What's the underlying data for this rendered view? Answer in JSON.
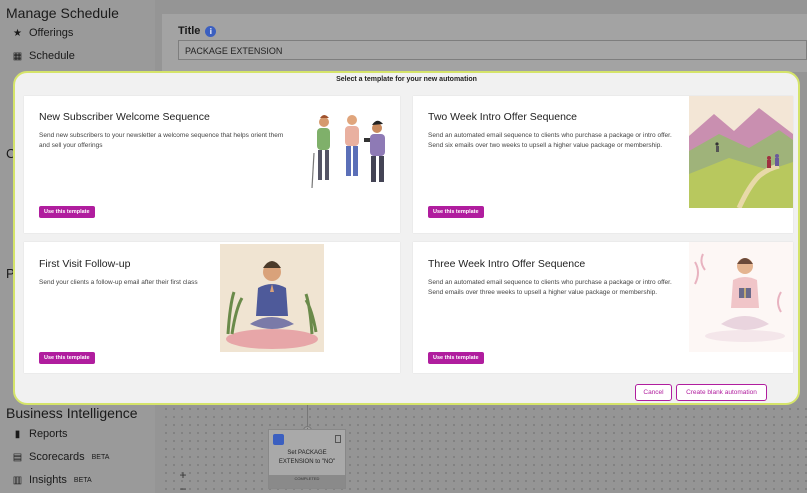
{
  "sidebar": {
    "manage_title": "Manage Schedule",
    "offerings": "Offerings",
    "schedule": "Schedule",
    "frag_c": "C",
    "frag_p": "P",
    "bi_title": "Business Intelligence",
    "reports": "Reports",
    "scorecards": "Scorecards",
    "insights": "Insights",
    "beta": "BETA"
  },
  "form": {
    "title_label": "Title",
    "title_value": "PACKAGE EXTENSION"
  },
  "canvas": {
    "node_text": "Set PACKAGE EXTENSION to \"NO\"",
    "node_footer": "COMPLETED",
    "zoom_in": "+",
    "zoom_out": "−"
  },
  "modal": {
    "header": "Select a template for your new automation",
    "use_label": "Use this template",
    "cancel_label": "Cancel",
    "blank_label": "Create blank automation",
    "cards": [
      {
        "title": "New Subscriber Welcome Sequence",
        "description": "Send new subscribers to your newsletter a welcome sequence that helps orient them and sell your offerings"
      },
      {
        "title": "Two Week Intro Offer Sequence",
        "description": "Send an automated email sequence to clients who purchase a package or intro offer. Send six emails over two weeks to upsell a higher value package or membership."
      },
      {
        "title": "First Visit Follow-up",
        "description": "Send your clients a follow-up email after their first class"
      },
      {
        "title": "Three Week Intro Offer Sequence",
        "description": "Send an automated email sequence to clients who purchase a package or intro offer. Send emails over three weeks to upsell a higher value package or membership."
      }
    ]
  },
  "colors": {
    "accent": "#b01d9e",
    "modal_border": "#d5e46a"
  }
}
